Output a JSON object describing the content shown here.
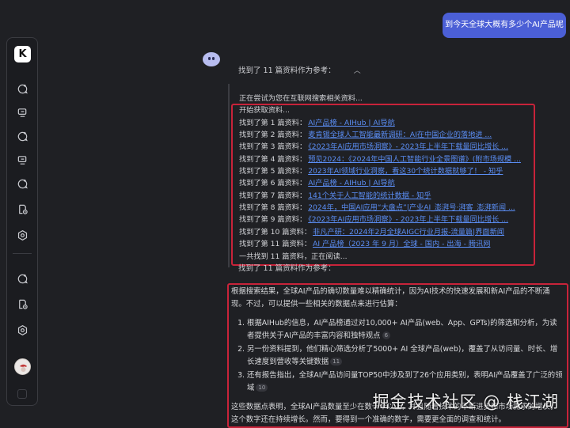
{
  "user_message": "到今天全球大概有多少个AI产品呢",
  "sidebar": {
    "logo_text": "K",
    "icons": [
      "chat-plus-icon",
      "chat-history-icon",
      "chat-plus-icon",
      "chat-history-icon",
      "chat-plus-icon",
      "document-clock-icon",
      "hexagon-gear-icon",
      "chat-plus-icon",
      "document-clock-icon",
      "hexagon-gear-icon"
    ]
  },
  "search": {
    "header": "找到了 11 篇资料作为参考：",
    "trying": "正在尝试为您在互联网搜索相关资料...",
    "start": "开始获取资料...",
    "results": [
      {
        "label": "找到了第 1 篇资料：",
        "title": "AI产品榜 - AIHub | AI导航"
      },
      {
        "label": "找到了第 2 篇资料：",
        "title": "麦肯锡全球人工智能最新调研：AI在中国企业的落地进 ..."
      },
      {
        "label": "找到了第 3 篇资料：",
        "title": "《2023年AI应用市场洞察》- 2023年上半年下载量同比增长 ..."
      },
      {
        "label": "找到了第 4 篇资料：",
        "title": "预见2024：《2024年中国人工智能行业全景图谱》(附市场规模 ..."
      },
      {
        "label": "找到了第 5 篇资料：",
        "title": "2023年AI领域行业洞察，看这30个统计数据就够了！ - 知乎"
      },
      {
        "label": "找到了第 6 篇资料：",
        "title": "AI产品榜 - AIHub | AI导航"
      },
      {
        "label": "找到了第 7 篇资料：",
        "title": "141个关于人工智能的统计数据 - 知乎"
      },
      {
        "label": "找到了第 8 篇资料：",
        "title": "2024年，中国AI应用“大盘点”|产业AI_澎湃号·湃客_澎湃新闻 ..."
      },
      {
        "label": "找到了第 9 篇资料：",
        "title": "《2023年AI应用市场洞察》- 2023年上半年下载量同比增长 ..."
      },
      {
        "label": "找到了第 10 篇资料：",
        "title": "非凡产研：2024年2月全球AIGC行业月报-流量篇|界面新闻"
      },
      {
        "label": "找到了第 11 篇资料：",
        "title": "AI 产品榜（2023 年 9 月）全球 - 国内 - 出海 - 腾讯网"
      }
    ],
    "summary": "一共找到 11 篇资料，正在阅读...",
    "footer": "找到了 11 篇资料作为参考："
  },
  "answer": {
    "intro": "根据搜索结果，全球AI产品的确切数量难以精确统计，因为AI技术的快速发展和新AI产品的不断涌现。不过，可以提供一些相关的数据点来进行估算：",
    "points": [
      {
        "text": "根据AIHub的信息，AI产品榜通过对10,000+ AI产品(web、App、GPTs)的筛选和分析，为读者提供关于AI产品的丰富内容和独特观点",
        "ref": "6"
      },
      {
        "text": "另一份资料提到，他们精心筛选分析了5000+ AI 全球产品(web)，覆盖了从访问量、时长、增长速度到营收等关键数据",
        "ref": "11"
      },
      {
        "text": "还有报告指出，全球AI产品访问量TOP50中涉及到了26个应用类别，表明AI产品覆盖了广泛的领域",
        "ref": "10"
      }
    ],
    "conclusion": "这些数据点表明，全球AI产品数量至少在数千个以上，并且随着技术的不断进步和市场需求的增长，这个数字还在持续增长。然而，要得到一个准确的数字，需要更全面的调查和统计。"
  },
  "watermark": "掘金技术社区 @ 栈江湖"
}
